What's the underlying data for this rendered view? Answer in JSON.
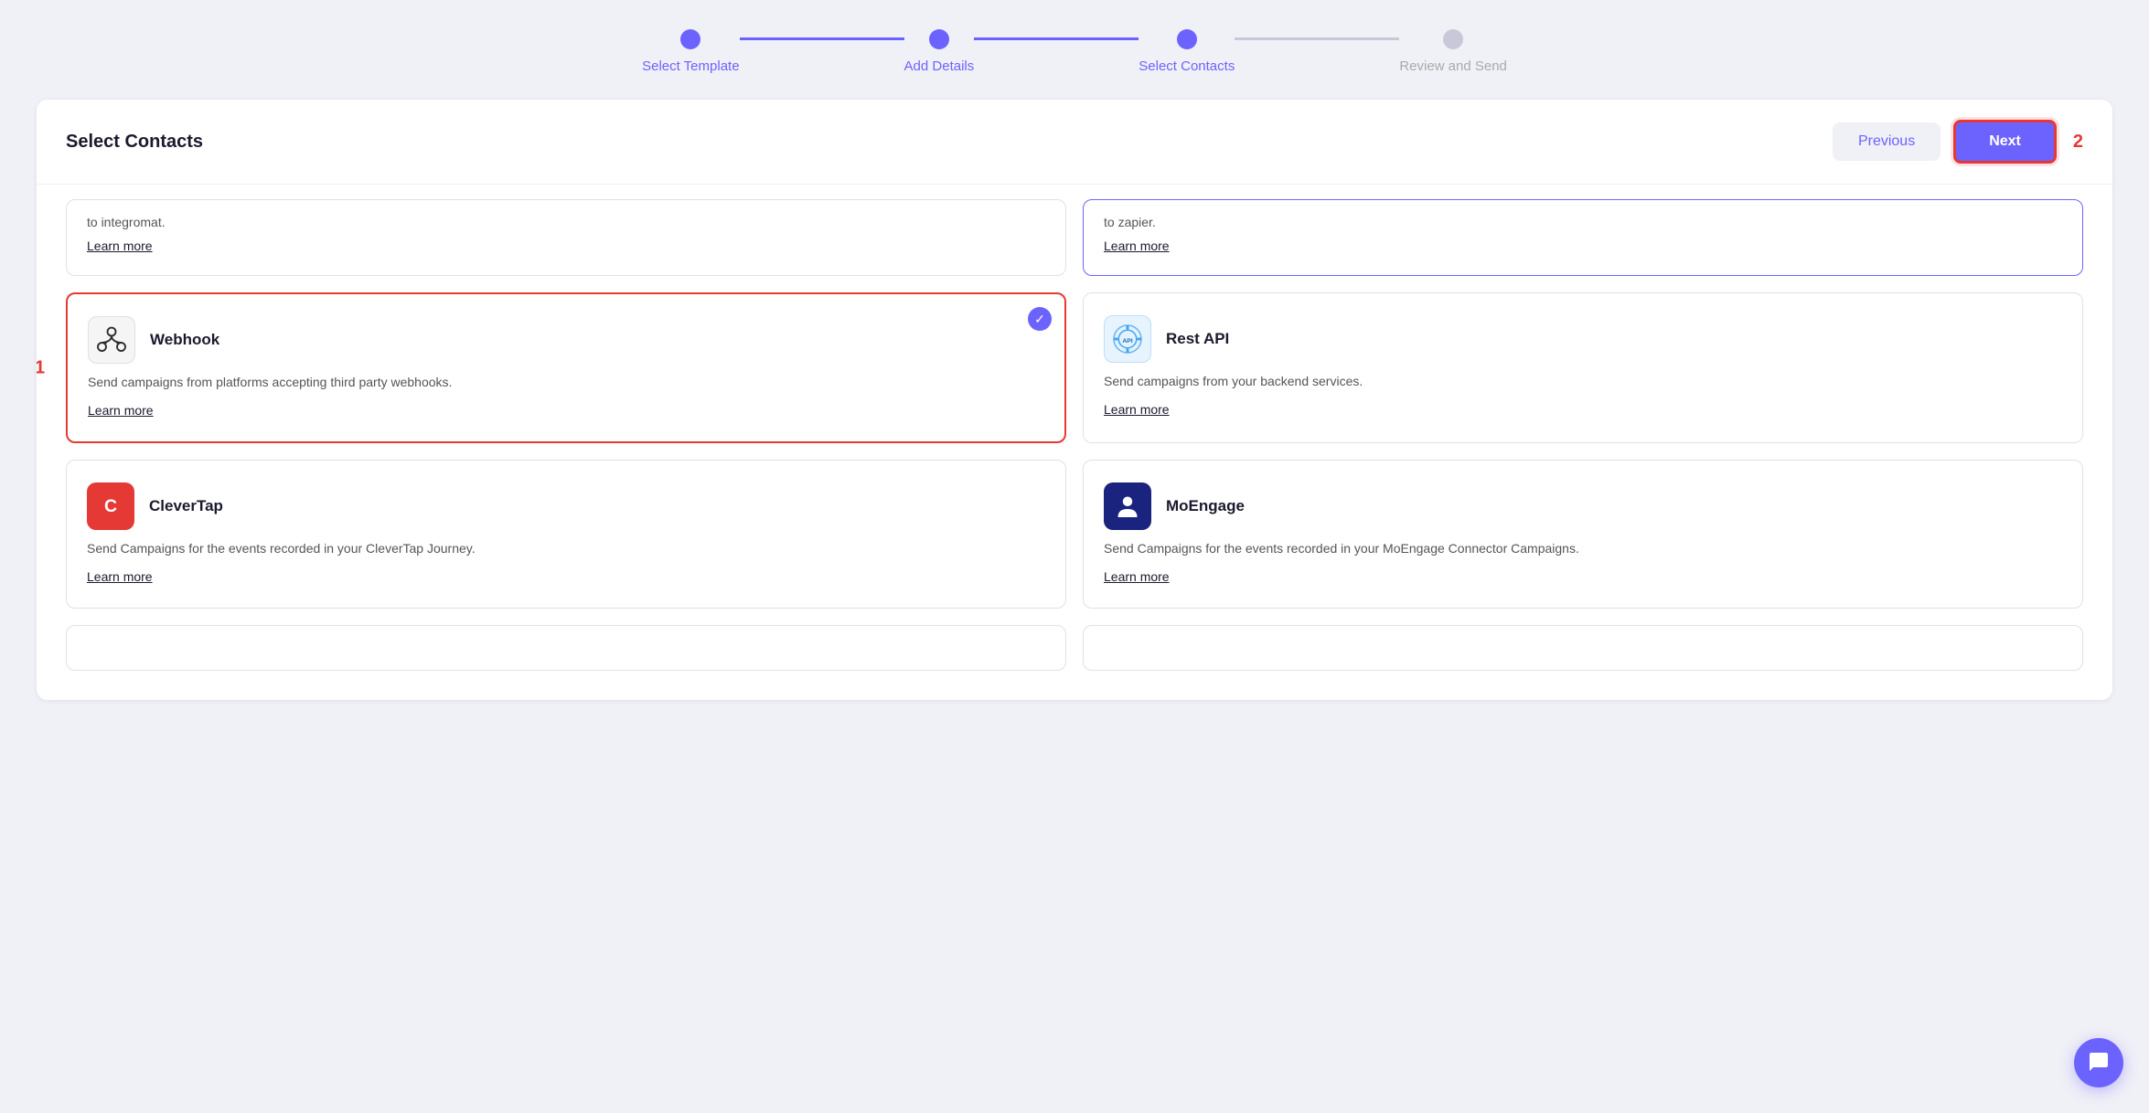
{
  "stepper": {
    "steps": [
      {
        "label": "Select Template",
        "active": true
      },
      {
        "label": "Add Details",
        "active": true
      },
      {
        "label": "Select Contacts",
        "active": true
      },
      {
        "label": "Review and Send",
        "active": false
      }
    ]
  },
  "header": {
    "title": "Select Contacts",
    "previous_label": "Previous",
    "next_label": "Next",
    "badge": "2"
  },
  "partial_cards": [
    {
      "text": "to integromat.",
      "learn_more": "Learn more",
      "highlighted": false
    },
    {
      "text": "to zapier.",
      "learn_more": "Learn more",
      "highlighted": true
    }
  ],
  "option_cards": [
    {
      "id": "webhook",
      "name": "Webhook",
      "desc": "Send campaigns from platforms accepting third party webhooks.",
      "learn_more": "Learn more",
      "selected": true,
      "highlighted": false,
      "badge_label": "1"
    },
    {
      "id": "restapi",
      "name": "Rest API",
      "desc": "Send campaigns from your backend services.",
      "learn_more": "Learn more",
      "selected": false,
      "highlighted": false
    },
    {
      "id": "clevertap",
      "name": "CleverTap",
      "desc": "Send Campaigns for the events recorded in your CleverTap Journey.",
      "learn_more": "Learn more",
      "selected": false,
      "highlighted": false
    },
    {
      "id": "moengage",
      "name": "MoEngage",
      "desc": "Send Campaigns for the events recorded in your MoEngage Connector Campaigns.",
      "learn_more": "Learn more",
      "selected": false,
      "highlighted": false
    }
  ],
  "bottom_partial": [
    {
      "visible": true
    },
    {
      "visible": true
    }
  ],
  "chat": {
    "icon": "💬"
  }
}
